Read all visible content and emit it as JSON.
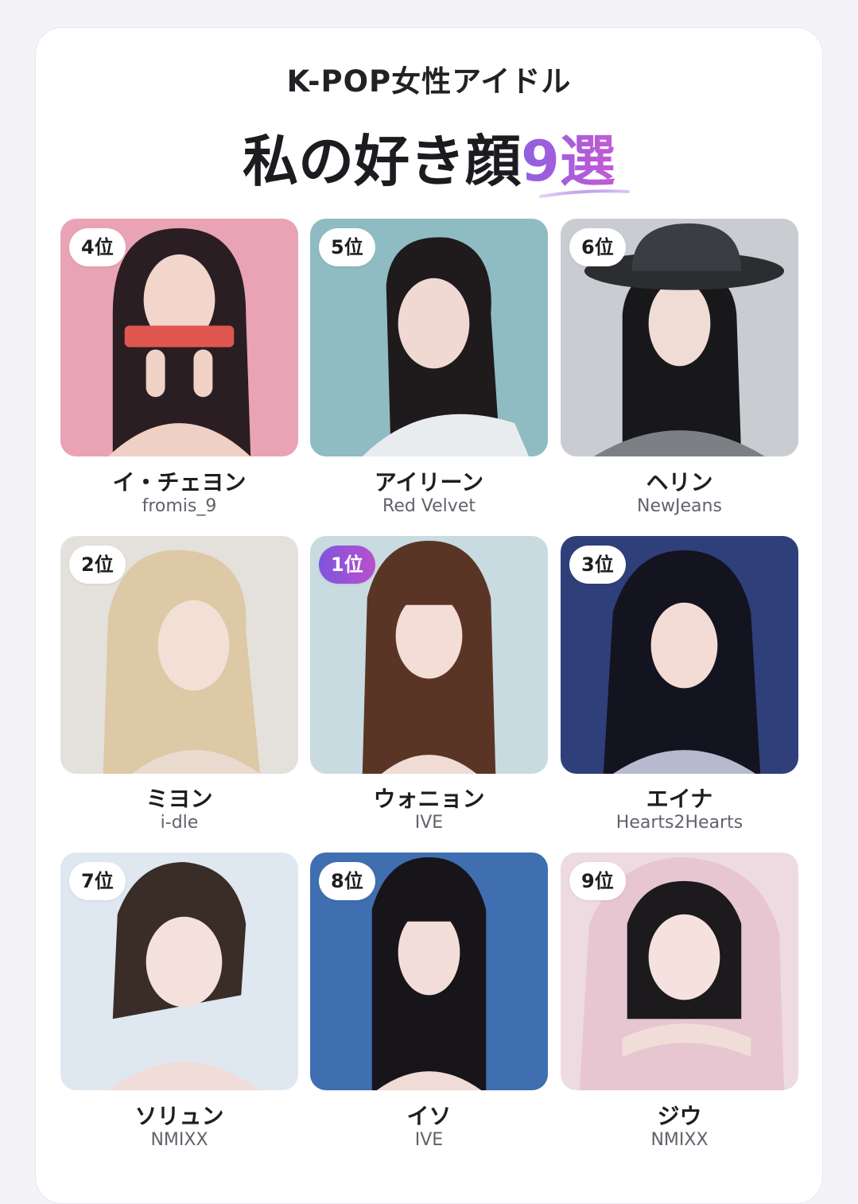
{
  "header": {
    "subtitle": "K-POP女性アイドル",
    "title_main": "私の好き顔",
    "title_accent": "9選"
  },
  "colors": {
    "accent_start": "#8f5fe0",
    "accent_end": "#c25bd4"
  },
  "items": [
    {
      "rank": "4位",
      "name": "イ・チェヨン",
      "group": "fromis_9",
      "image": "portrait-pink-background-holding-vitamin-stick"
    },
    {
      "rank": "5位",
      "name": "アイリーン",
      "group": "Red Velvet",
      "image": "portrait-teal-background"
    },
    {
      "rank": "6位",
      "name": "ヘリン",
      "group": "NewJeans",
      "image": "portrait-wearing-black-hat"
    },
    {
      "rank": "2位",
      "name": "ミヨン",
      "group": "i-dle",
      "image": "portrait-blonde-wavy-hair"
    },
    {
      "rank": "1位",
      "name": "ウォニョン",
      "group": "IVE",
      "image": "portrait-long-brown-hair-bangs"
    },
    {
      "rank": "3位",
      "name": "エイナ",
      "group": "Hearts2Hearts",
      "image": "portrait-dark-blue-background"
    },
    {
      "rank": "7位",
      "name": "ソリュン",
      "group": "NMIXX",
      "image": "portrait-pale-blue-background"
    },
    {
      "rank": "8位",
      "name": "イソ",
      "group": "IVE",
      "image": "portrait-blue-background-bangs"
    },
    {
      "rank": "9位",
      "name": "ジウ",
      "group": "NMIXX",
      "image": "portrait-pink-hood-hands-under-chin"
    }
  ]
}
